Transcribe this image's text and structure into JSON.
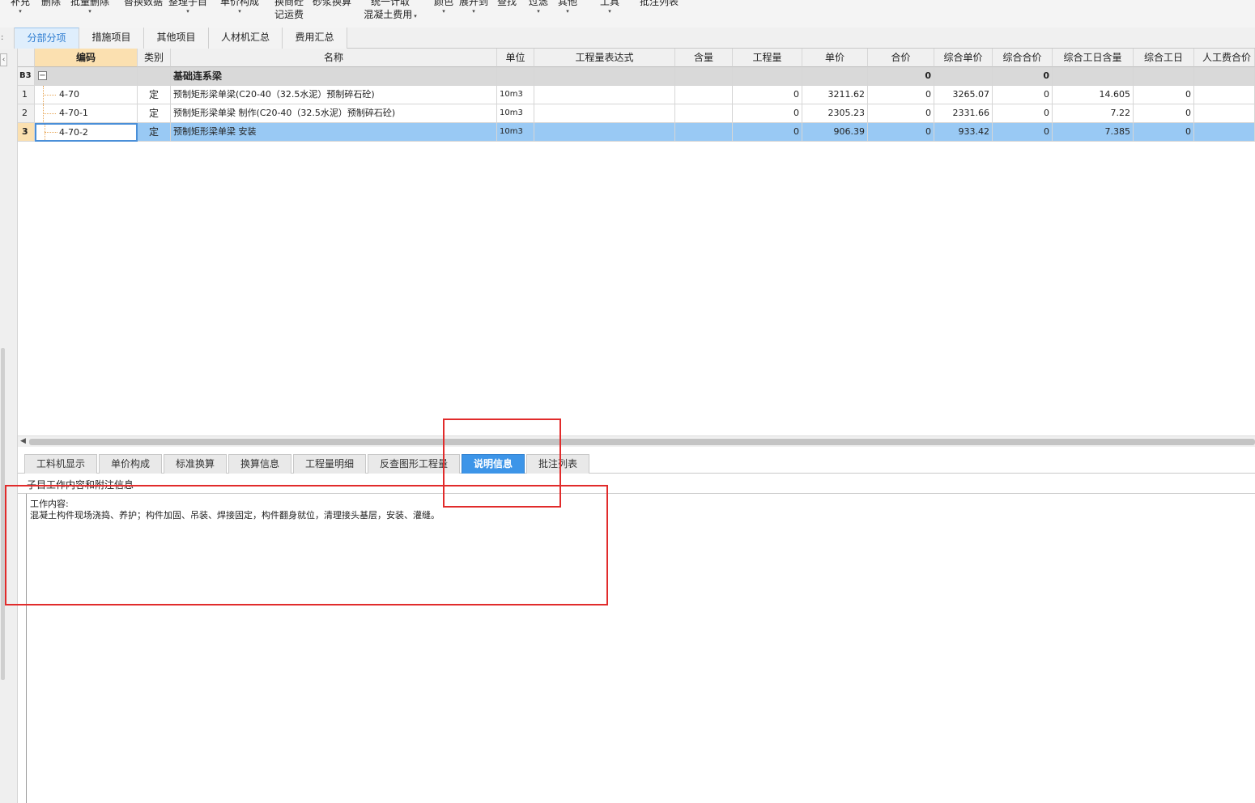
{
  "toolbar": {
    "buttons": [
      {
        "line1": "补充",
        "line2": "",
        "arrow": "▾"
      },
      {
        "line1": "删除",
        "line2": "",
        "arrow": ""
      },
      {
        "line1": "批量删除",
        "line2": "",
        "arrow": "▾"
      },
      {
        "line1": "替换数据",
        "line2": "",
        "arrow": ""
      },
      {
        "line1": "整理子目",
        "line2": "",
        "arrow": "▾"
      },
      {
        "line1": "单价构成",
        "line2": "",
        "arrow": "▾"
      },
      {
        "line1": "换商砼",
        "line2": "记运费",
        "arrow": ""
      },
      {
        "line1": "砂浆换算",
        "line2": "",
        "arrow": ""
      },
      {
        "line1": "统一计取",
        "line2": "混凝土费用",
        "arrow": "▾"
      },
      {
        "line1": "颜色",
        "line2": "",
        "arrow": "▾"
      },
      {
        "line1": "展开到",
        "line2": "",
        "arrow": "▾"
      },
      {
        "line1": "查找",
        "line2": "",
        "arrow": ""
      },
      {
        "line1": "过滤",
        "line2": "",
        "arrow": "▾"
      },
      {
        "line1": "其他",
        "line2": "",
        "arrow": "▾"
      },
      {
        "line1": "工具",
        "line2": "",
        "arrow": "▾"
      },
      {
        "line1": "批注列表",
        "line2": "",
        "arrow": ""
      }
    ]
  },
  "main_tabs": [
    {
      "label": "分部分项",
      "active": true
    },
    {
      "label": "措施项目",
      "active": false
    },
    {
      "label": "其他项目",
      "active": false
    },
    {
      "label": "人材机汇总",
      "active": false
    },
    {
      "label": "费用汇总",
      "active": false
    }
  ],
  "grid": {
    "headers": [
      "",
      "编码",
      "类别",
      "名称",
      "单位",
      "工程量表达式",
      "含量",
      "工程量",
      "单价",
      "合价",
      "综合单价",
      "综合合价",
      "综合工日含量",
      "综合工日",
      "人工费合价"
    ],
    "rows": [
      {
        "idx": "B3",
        "code": "",
        "type": "",
        "name": "基础连系梁",
        "unit": "",
        "expr": "",
        "content": "",
        "qty": "",
        "price": "",
        "total": "0",
        "comp_price": "",
        "comp_total": "0",
        "labor_content": "",
        "labor_days": "",
        "labor_cost": "",
        "kind": "group"
      },
      {
        "idx": "1",
        "code": "4-70",
        "type": "定",
        "name": "预制矩形梁单梁(C20-40（32.5水泥）预制碎石砼)",
        "unit": "10m3",
        "expr": "",
        "content": "",
        "qty": "0",
        "price": "3211.62",
        "total": "0",
        "comp_price": "3265.07",
        "comp_total": "0",
        "labor_content": "14.605",
        "labor_days": "0",
        "labor_cost": "",
        "kind": "item"
      },
      {
        "idx": "2",
        "code": "4-70-1",
        "type": "定",
        "name": "预制矩形梁单梁 制作(C20-40（32.5水泥）预制碎石砼)",
        "unit": "10m3",
        "expr": "",
        "content": "",
        "qty": "0",
        "price": "2305.23",
        "total": "0",
        "comp_price": "2331.66",
        "comp_total": "0",
        "labor_content": "7.22",
        "labor_days": "0",
        "labor_cost": "",
        "kind": "item"
      },
      {
        "idx": "3",
        "code": "4-70-2",
        "type": "定",
        "name": "预制矩形梁单梁 安装",
        "unit": "10m3",
        "expr": "",
        "content": "",
        "qty": "0",
        "price": "906.39",
        "total": "0",
        "comp_price": "933.42",
        "comp_total": "0",
        "labor_content": "7.385",
        "labor_days": "0",
        "labor_cost": "",
        "kind": "selected"
      }
    ]
  },
  "bottom_tabs": [
    {
      "label": "工料机显示",
      "active": false
    },
    {
      "label": "单价构成",
      "active": false
    },
    {
      "label": "标准换算",
      "active": false
    },
    {
      "label": "换算信息",
      "active": false
    },
    {
      "label": "工程量明细",
      "active": false
    },
    {
      "label": "反查图形工程量",
      "active": false
    },
    {
      "label": "说明信息",
      "active": true
    },
    {
      "label": "批注列表",
      "active": false
    }
  ],
  "description": {
    "title": "子目工作内容和附注信息",
    "line1": "工作内容:",
    "line2": "混凝土构件现场浇捣、养护；构件加固、吊装、焊接固定，构件翻身就位，清理接头基层，安装、灌缝。"
  },
  "colors": {
    "active_main_tab": "#dfeefc",
    "active_bottom_tab": "#3d95e8",
    "selected_row": "#99c9f4",
    "group_row": "#d9d9d9",
    "annotation_red": "#e12b2b"
  }
}
